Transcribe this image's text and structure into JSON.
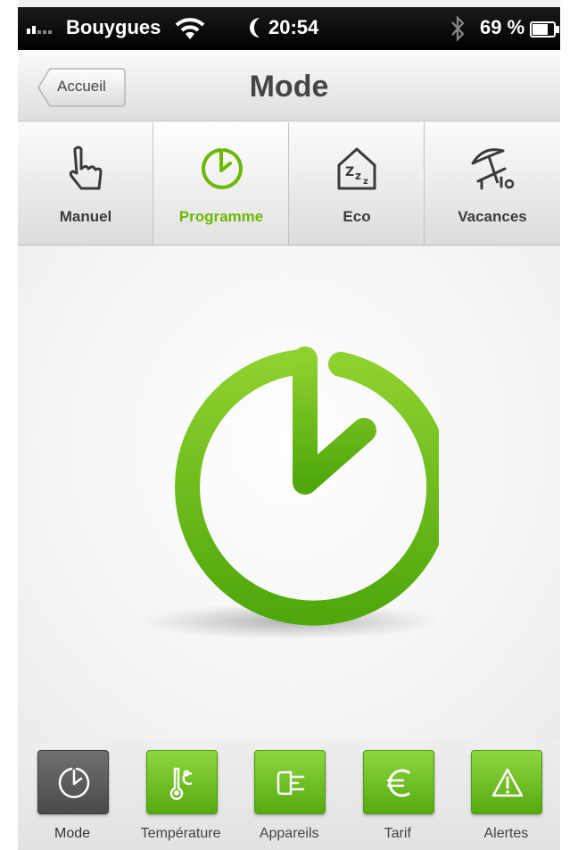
{
  "status_bar": {
    "carrier": "Bouygues",
    "time": "20:54",
    "battery": "69 %"
  },
  "nav": {
    "back_label": "Accueil",
    "title": "Mode"
  },
  "modes": [
    {
      "label": "Manuel",
      "icon": "hand-pointer-icon",
      "active": false
    },
    {
      "label": "Programme",
      "icon": "clock-icon",
      "active": true
    },
    {
      "label": "Eco",
      "icon": "house-sleep-icon",
      "active": false
    },
    {
      "label": "Vacances",
      "icon": "beach-umbrella-icon",
      "active": false
    }
  ],
  "main": {
    "selected_mode_icon": "clock-icon"
  },
  "tabs": [
    {
      "label": "Mode",
      "icon": "clock-icon",
      "active": true
    },
    {
      "label": "Température",
      "icon": "thermometer-icon",
      "active": false
    },
    {
      "label": "Appareils",
      "icon": "plug-icon",
      "active": false
    },
    {
      "label": "Tarif",
      "icon": "euro-icon",
      "active": false
    },
    {
      "label": "Alertes",
      "icon": "warning-icon",
      "active": false
    }
  ],
  "colors": {
    "accent_green": "#6ab800",
    "tab_green": "#5aad12",
    "tab_active_gray": "#555555"
  }
}
